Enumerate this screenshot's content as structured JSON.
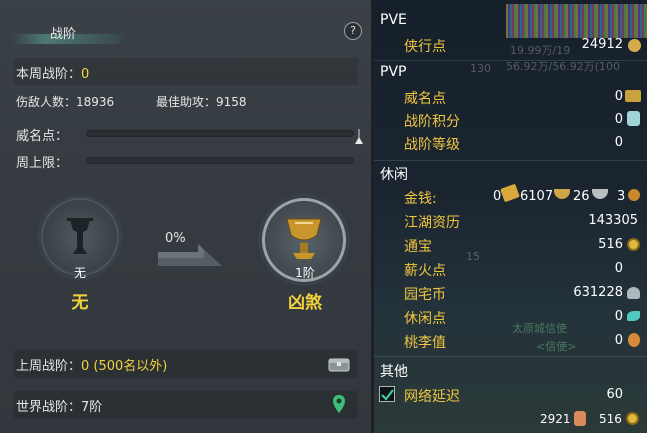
{
  "left_panel": {
    "title": "战阶",
    "help": "?",
    "week_rank_label": "本周战阶：",
    "week_rank_value": "0",
    "damage_count_label": "伤敌人数：",
    "damage_count_value": "18936",
    "best_assist_label": "最佳助攻：",
    "best_assist_value": "9158",
    "prestige_label": "威名点：",
    "weekly_cap_label": "周上限：",
    "current_rank": {
      "small": "无",
      "big": "无"
    },
    "progress_percent": "0%",
    "next_rank": {
      "small": "1阶",
      "big": "凶煞"
    },
    "last_week_label": "上周战阶：",
    "last_week_value": "0 (500名以外)",
    "world_rank_label": "世界战阶：",
    "world_rank_value": "7阶"
  },
  "right_panel": {
    "pve": {
      "header": "PVE",
      "items": [
        {
          "label": "侠行点",
          "value": "24912"
        }
      ]
    },
    "pvp": {
      "header": "PVP",
      "items": [
        {
          "label": "威名点",
          "value": "0"
        },
        {
          "label": "战阶积分",
          "value": "0"
        },
        {
          "label": "战阶等级",
          "value": "0"
        }
      ]
    },
    "leisure": {
      "header": "休闲",
      "money_label": "金钱:",
      "money_values": [
        "0",
        "6107",
        "26",
        "3"
      ],
      "items": [
        {
          "label": "江湖资历",
          "value": "143305"
        },
        {
          "label": "通宝",
          "value": "516"
        },
        {
          "label": "薪火点",
          "value": "0"
        },
        {
          "label": "园宅币",
          "value": "631228"
        },
        {
          "label": "休闲点",
          "value": "0"
        },
        {
          "label": "桃李值",
          "value": "0"
        }
      ]
    },
    "other": {
      "header": "其他",
      "items": [
        {
          "label": "网络延迟",
          "value": "60",
          "checked": true
        }
      ]
    },
    "footer": {
      "left_value": "2921",
      "right_value": "516"
    },
    "background_text": {
      "gauge_1": "19.99万/19",
      "gauge_2": "56.92万/56.92万(100",
      "level_a": "130",
      "level_b": "15",
      "place": "太原城信使",
      "place_sub": "<信使>"
    }
  },
  "colors": {
    "accent_gold": "#f3d33a",
    "label_gold": "#f0c640"
  }
}
